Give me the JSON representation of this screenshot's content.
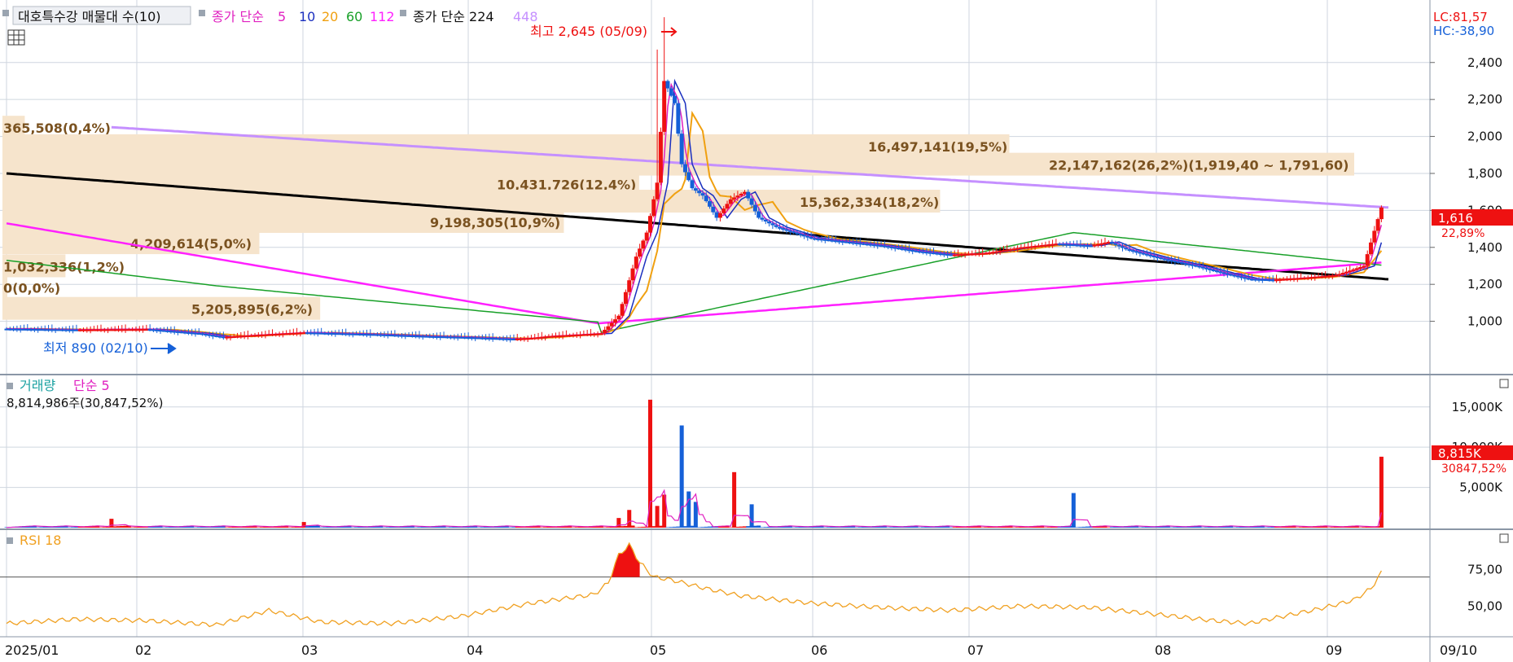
{
  "legend": {
    "series_name": "대호특수강 매물대 수(10)",
    "ma_label": "종가 단순",
    "ma_periods": [
      "5",
      "10",
      "20",
      "60",
      "112"
    ],
    "ma_colors": [
      "#e020c0",
      "#1a2fbf",
      "#f0a010",
      "#18a028",
      "#ff20ff"
    ],
    "ma2_label": "종가 단순 224",
    "ma2_extra": "448"
  },
  "price_panel": {
    "lc": "LC:81,57",
    "hc": "HC:-38,90",
    "last_price": "1,616",
    "last_change": "22,89%",
    "high_marker": "최고 2,645 (05/09)",
    "low_marker": "최저 890 (02/10)",
    "y_ticks": [
      "2,400",
      "2,200",
      "2,000",
      "1,800",
      "1,600",
      "1,400",
      "1,200",
      "1,000"
    ]
  },
  "volume_panel": {
    "title_a": "거래량",
    "title_b": "단순 5",
    "summary": "8,814,986주(30,847,52%)",
    "last_value": "8,815K",
    "last_pct": "30847,52%",
    "y_ticks": [
      "15,000K",
      "10,000K",
      "5,000K"
    ]
  },
  "rsi_panel": {
    "title": "RSI 18",
    "y_ticks": [
      "75,00",
      "50,00"
    ]
  },
  "x_labels": [
    "2025/01",
    "02",
    "03",
    "04",
    "05",
    "06",
    "07",
    "08",
    "09"
  ],
  "x_right_label": "09/10",
  "colors": {
    "up": "#ee1111",
    "down": "#1560d8",
    "profile": "#f6e4cc",
    "profile_text": "#7a5220",
    "ma224": "#000000",
    "ma448": "#c590ff",
    "rsi": "#f0a020",
    "vol_ma": "#e020c0",
    "grid": "#cfd6df"
  },
  "chart_data": {
    "type": "candlestick",
    "price_axis": [
      800,
      2650
    ],
    "volume_axis_k": [
      0,
      17000
    ],
    "rsi_axis": [
      30,
      100
    ],
    "volume_profile": [
      {
        "label": "365,508(0,4%)",
        "price": 2050,
        "volume": 365508
      },
      {
        "label": "16,497,141(19,5%)",
        "price": 1950,
        "volume": 16497141
      },
      {
        "label": "22,147,162(26,2%)(1,919,40 ~ 1,791,60)",
        "price": 1850,
        "volume": 22147162
      },
      {
        "label": "10,431,726(12,4%)",
        "price": 1745,
        "volume": 10431726
      },
      {
        "label": "15,362,334(18,2%)",
        "price": 1650,
        "volume": 15362334
      },
      {
        "label": "9,198,305(10,9%)",
        "price": 1540,
        "volume": 9198305
      },
      {
        "label": "4,209,614(5,0%)",
        "price": 1425,
        "volume": 4209614
      },
      {
        "label": "1,032,336(1,2%)",
        "price": 1300,
        "volume": 1032336
      },
      {
        "label": "0(0,0%)",
        "price": 1185,
        "volume": 0
      },
      {
        "label": "5,205,895(6,2%)",
        "price": 1070,
        "volume": 5205895
      }
    ],
    "close_path": [
      [
        0,
        960
      ],
      [
        20,
        955
      ],
      [
        40,
        958
      ],
      [
        55,
        935
      ],
      [
        62,
        915
      ],
      [
        70,
        925
      ],
      [
        85,
        940
      ],
      [
        95,
        935
      ],
      [
        105,
        930
      ],
      [
        120,
        920
      ],
      [
        130,
        915
      ],
      [
        145,
        905
      ],
      [
        150,
        910
      ],
      [
        155,
        920
      ],
      [
        160,
        925
      ],
      [
        170,
        935
      ],
      [
        175,
        1030
      ],
      [
        180,
        1350
      ],
      [
        183,
        1480
      ],
      [
        186,
        1750
      ],
      [
        188,
        2300
      ],
      [
        191,
        2180
      ],
      [
        193,
        1850
      ],
      [
        196,
        1720
      ],
      [
        199,
        1680
      ],
      [
        203,
        1560
      ],
      [
        207,
        1660
      ],
      [
        211,
        1700
      ],
      [
        215,
        1560
      ],
      [
        220,
        1510
      ],
      [
        225,
        1480
      ],
      [
        230,
        1450
      ],
      [
        240,
        1430
      ],
      [
        250,
        1410
      ],
      [
        260,
        1380
      ],
      [
        270,
        1360
      ],
      [
        280,
        1370
      ],
      [
        290,
        1400
      ],
      [
        300,
        1420
      ],
      [
        310,
        1410
      ],
      [
        315,
        1430
      ],
      [
        320,
        1390
      ],
      [
        330,
        1340
      ],
      [
        340,
        1300
      ],
      [
        348,
        1260
      ],
      [
        355,
        1230
      ],
      [
        362,
        1225
      ],
      [
        370,
        1235
      ],
      [
        380,
        1250
      ],
      [
        388,
        1300
      ],
      [
        393,
        1616
      ]
    ],
    "volume_spikes_k": [
      {
        "d": 30,
        "v": 1100
      },
      {
        "d": 85,
        "v": 700
      },
      {
        "d": 175,
        "v": 1200
      },
      {
        "d": 178,
        "v": 2200
      },
      {
        "d": 184,
        "v": 15900
      },
      {
        "d": 186,
        "v": 2700
      },
      {
        "d": 188,
        "v": 4100
      },
      {
        "d": 193,
        "v": 12700
      },
      {
        "d": 195,
        "v": 4500
      },
      {
        "d": 197,
        "v": 3200
      },
      {
        "d": 208,
        "v": 6900
      },
      {
        "d": 213,
        "v": 2900
      },
      {
        "d": 305,
        "v": 4300
      },
      {
        "d": 393,
        "v": 8815
      }
    ],
    "rsi_path": [
      [
        0,
        38
      ],
      [
        20,
        41
      ],
      [
        40,
        40
      ],
      [
        60,
        37
      ],
      [
        75,
        47
      ],
      [
        90,
        39
      ],
      [
        110,
        38
      ],
      [
        130,
        43
      ],
      [
        150,
        52
      ],
      [
        168,
        58
      ],
      [
        172,
        66
      ],
      [
        175,
        85
      ],
      [
        178,
        92
      ],
      [
        181,
        80
      ],
      [
        185,
        70
      ],
      [
        190,
        68
      ],
      [
        200,
        62
      ],
      [
        210,
        57
      ],
      [
        230,
        52
      ],
      [
        250,
        49
      ],
      [
        270,
        47
      ],
      [
        290,
        50
      ],
      [
        310,
        49
      ],
      [
        330,
        44
      ],
      [
        345,
        40
      ],
      [
        355,
        38
      ],
      [
        365,
        43
      ],
      [
        375,
        48
      ],
      [
        385,
        54
      ],
      [
        390,
        62
      ],
      [
        393,
        73
      ]
    ]
  }
}
